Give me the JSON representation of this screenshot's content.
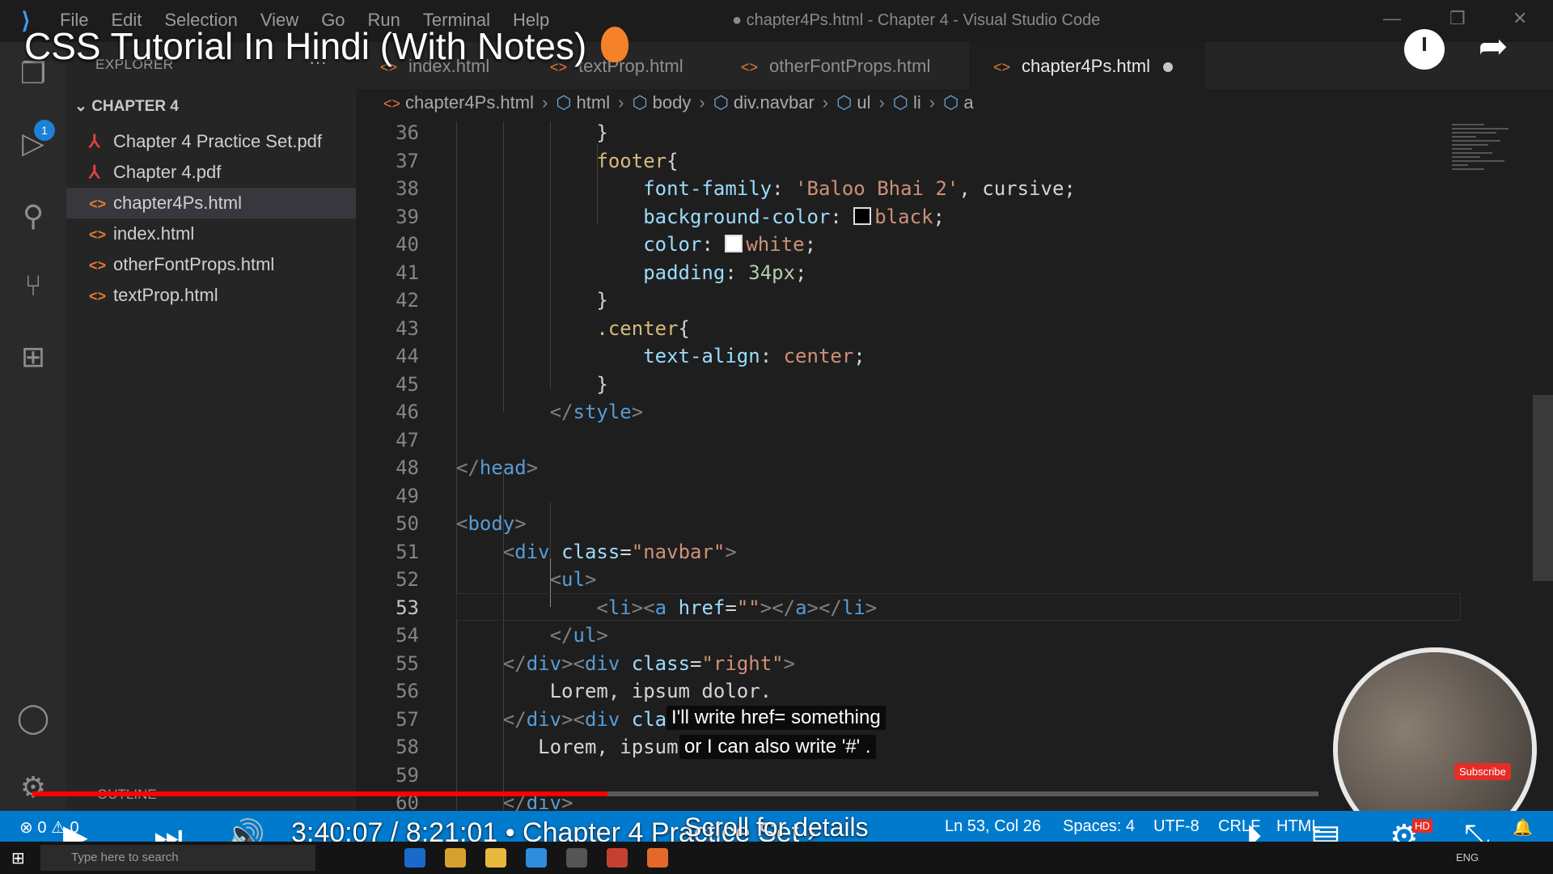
{
  "titlebar": {
    "menu": [
      "File",
      "Edit",
      "Selection",
      "View",
      "Go",
      "Run",
      "Terminal",
      "Help"
    ],
    "window_title": "● chapter4Ps.html - Chapter 4 - Visual Studio Code"
  },
  "activity_bar": {
    "explorer_badge": "1"
  },
  "sidebar": {
    "header": "EXPLORER",
    "folder": "CHAPTER 4",
    "files": [
      {
        "name": "Chapter 4 Practice Set.pdf",
        "type": "pdf"
      },
      {
        "name": "Chapter 4.pdf",
        "type": "pdf"
      },
      {
        "name": "chapter4Ps.html",
        "type": "html",
        "active": true
      },
      {
        "name": "index.html",
        "type": "html"
      },
      {
        "name": "otherFontProps.html",
        "type": "html"
      },
      {
        "name": "textProp.html",
        "type": "html"
      }
    ],
    "outline": "OUTLINE"
  },
  "tabs": [
    "index.html",
    "textProp.html",
    "otherFontProps.html",
    "chapter4Ps.html"
  ],
  "breadcrumb": [
    "chapter4Ps.html",
    "html",
    "body",
    "div.navbar",
    "ul",
    "li",
    "a"
  ],
  "editor": {
    "line_numbers": [
      "36",
      "37",
      "38",
      "39",
      "40",
      "41",
      "42",
      "43",
      "44",
      "45",
      "46",
      "47",
      "48",
      "49",
      "50",
      "51",
      "52",
      "53",
      "54",
      "55",
      "56",
      "57",
      "58",
      "59",
      "60"
    ],
    "current_line": "53",
    "lines": {
      "l36": "}",
      "l37_sel": "footer",
      "l38_prop": "font-family",
      "l38_val": "'Baloo Bhai 2'",
      "l38_rest": ", cursive;",
      "l39_prop": "background-color",
      "l39_val": "black",
      "l40_prop": "color",
      "l40_val": "white",
      "l41_prop": "padding",
      "l41_val": "34px",
      "l42": "}",
      "l43_sel": ".center",
      "l44_prop": "text-align",
      "l44_val": "center",
      "l45": "}",
      "l46_tag": "style",
      "l48_tag": "head",
      "l50_tag": "body",
      "l51_tag": "div",
      "l51_attr": "class",
      "l51_val": "\"navbar\"",
      "l52_tag": "ul",
      "l53_attr": "href",
      "l53_val": "\"\"",
      "l54_tag": "ul",
      "l55_attr": "class",
      "l55_val": "\"right\"",
      "l56": "Lorem, ipsum dolor.",
      "l57_attr": "cla",
      "l58": "Lorem, ipsum"
    }
  },
  "video": {
    "title": "CSS Tutorial In Hindi (With Notes)",
    "captions": [
      "I'll write href= something",
      "or I can also write '#' ."
    ],
    "time_current": "3:40:07",
    "time_total": "8:21:01",
    "chapter": "• Chapter 4 Practice Set",
    "scroll_hint": "Scroll for details",
    "progress_fraction": 0.447,
    "subscribe": "Subscribe",
    "hd_badge": "HD"
  },
  "statusbar": {
    "errors": "0",
    "warnings": "0",
    "position": "Ln 53, Col 26",
    "spaces": "Spaces: 4",
    "encoding": "UTF-8",
    "eol": "CRLF",
    "language": "HTML"
  },
  "taskbar": {
    "search_placeholder": "Type here to search",
    "lang": "ENG"
  },
  "colors": {
    "accent": "#007acc",
    "progress": "#ff0000",
    "editor_bg": "#1e1e1e"
  }
}
